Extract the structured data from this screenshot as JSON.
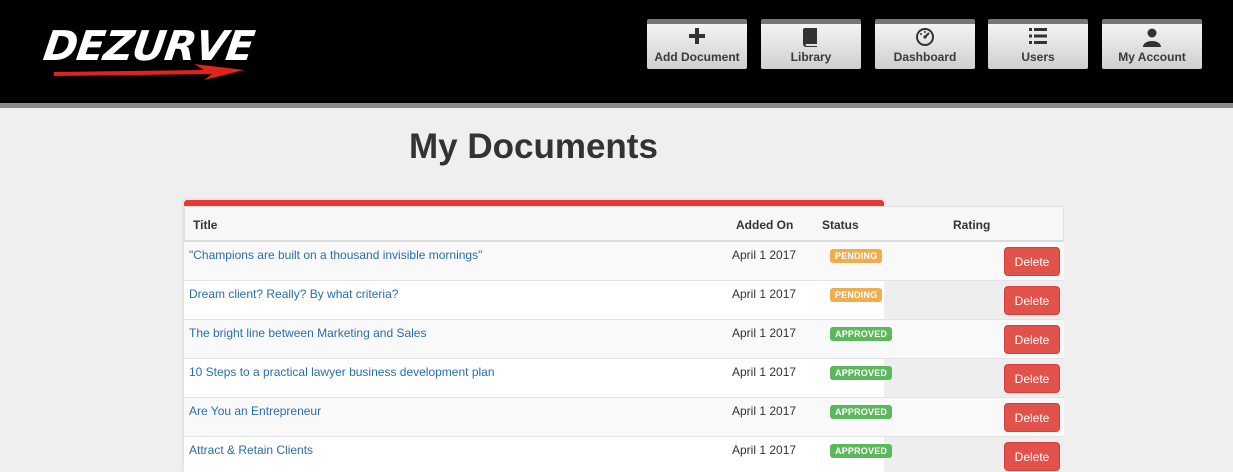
{
  "brand": {
    "name": "DEZURVE",
    "swoosh_color": "#e0241d"
  },
  "nav": [
    {
      "label": "Add Document",
      "icon": "plus-icon"
    },
    {
      "label": "Library",
      "icon": "book-icon"
    },
    {
      "label": "Dashboard",
      "icon": "dashboard-icon"
    },
    {
      "label": "Users",
      "icon": "list-icon"
    },
    {
      "label": "My Account",
      "icon": "user-icon"
    }
  ],
  "page": {
    "title": "My Documents"
  },
  "table": {
    "headers": {
      "title": "Title",
      "added_on": "Added On",
      "status": "Status",
      "rating": "Rating"
    },
    "rows": [
      {
        "title": "\"Champions are built on a thousand invisible mornings\"",
        "added_on": "April 1 2017",
        "status": "PENDING",
        "action": "Delete"
      },
      {
        "title": "Dream client? Really? By what criteria?",
        "added_on": "April 1 2017",
        "status": "PENDING",
        "action": "Delete"
      },
      {
        "title": "The bright line between Marketing and Sales",
        "added_on": "April 1 2017",
        "status": "APPROVED",
        "action": "Delete"
      },
      {
        "title": "10 Steps to a practical lawyer business development plan",
        "added_on": "April 1 2017",
        "status": "APPROVED",
        "action": "Delete"
      },
      {
        "title": "Are You an Entrepreneur",
        "added_on": "April 1 2017",
        "status": "APPROVED",
        "action": "Delete"
      },
      {
        "title": "Attract & Retain Clients",
        "added_on": "April 1 2017",
        "status": "APPROVED",
        "action": "Delete"
      }
    ]
  },
  "colors": {
    "accent": "#e33b34",
    "pending": "#f0ad4e",
    "approved": "#5cb85c",
    "delete": "#e0524a",
    "link": "#2a6db4"
  }
}
